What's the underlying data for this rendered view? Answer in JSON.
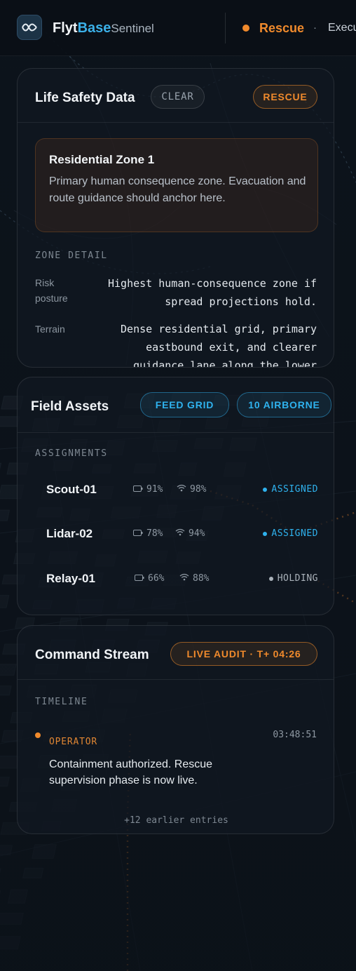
{
  "header": {
    "brand_part1": "Flyt",
    "brand_part2": "Base",
    "brand_part3": "Sentinel",
    "mode_label": "Rescue",
    "mode_separator": "·",
    "mode_next": "Execu",
    "mode_color": "#f08a2c"
  },
  "life_safety": {
    "title": "Life Safety Data",
    "clear_label": "CLEAR",
    "status_label": "RESCUE",
    "zone_title": "Residential Zone 1",
    "zone_description": "Primary human consequence zone. Evacuation and route guidance should anchor here.",
    "detail_heading": "ZONE DETAIL",
    "details": [
      {
        "key": "Risk posture",
        "value": "Highest human-consequence zone if spread projections hold."
      },
      {
        "key": "Terrain",
        "value": "Dense residential grid, primary eastbound exit, and clearer guidance lane along the lower"
      }
    ]
  },
  "field_assets": {
    "title": "Field Assets",
    "feed_grid_label": "FEED GRID",
    "airborne_label": "10 AIRBORNE",
    "section_label": "ASSIGNMENTS",
    "assets": [
      {
        "name": "Scout-01",
        "battery": "91%",
        "signal": "98%",
        "status": "ASSIGNED",
        "status_color": "#2fb2ee"
      },
      {
        "name": "Lidar-02",
        "battery": "78%",
        "signal": "94%",
        "status": "ASSIGNED",
        "status_color": "#2fb2ee"
      },
      {
        "name": "Relay-01",
        "battery": "66%",
        "signal": "88%",
        "status": "HOLDING",
        "status_color": "#aab2ba"
      }
    ]
  },
  "command_stream": {
    "title": "Command Stream",
    "audit_label": "LIVE AUDIT · T+ 04:26",
    "section_label": "TIMELINE",
    "entries": [
      {
        "actor": "OPERATOR",
        "time": "03:48:51",
        "text": "Containment authorized. Rescue supervision phase is now live."
      }
    ],
    "earlier_label": "+12 earlier entries"
  },
  "colors": {
    "accent_orange": "#f08a2c",
    "accent_blue": "#2fb2ee",
    "background": "#0b1118"
  }
}
